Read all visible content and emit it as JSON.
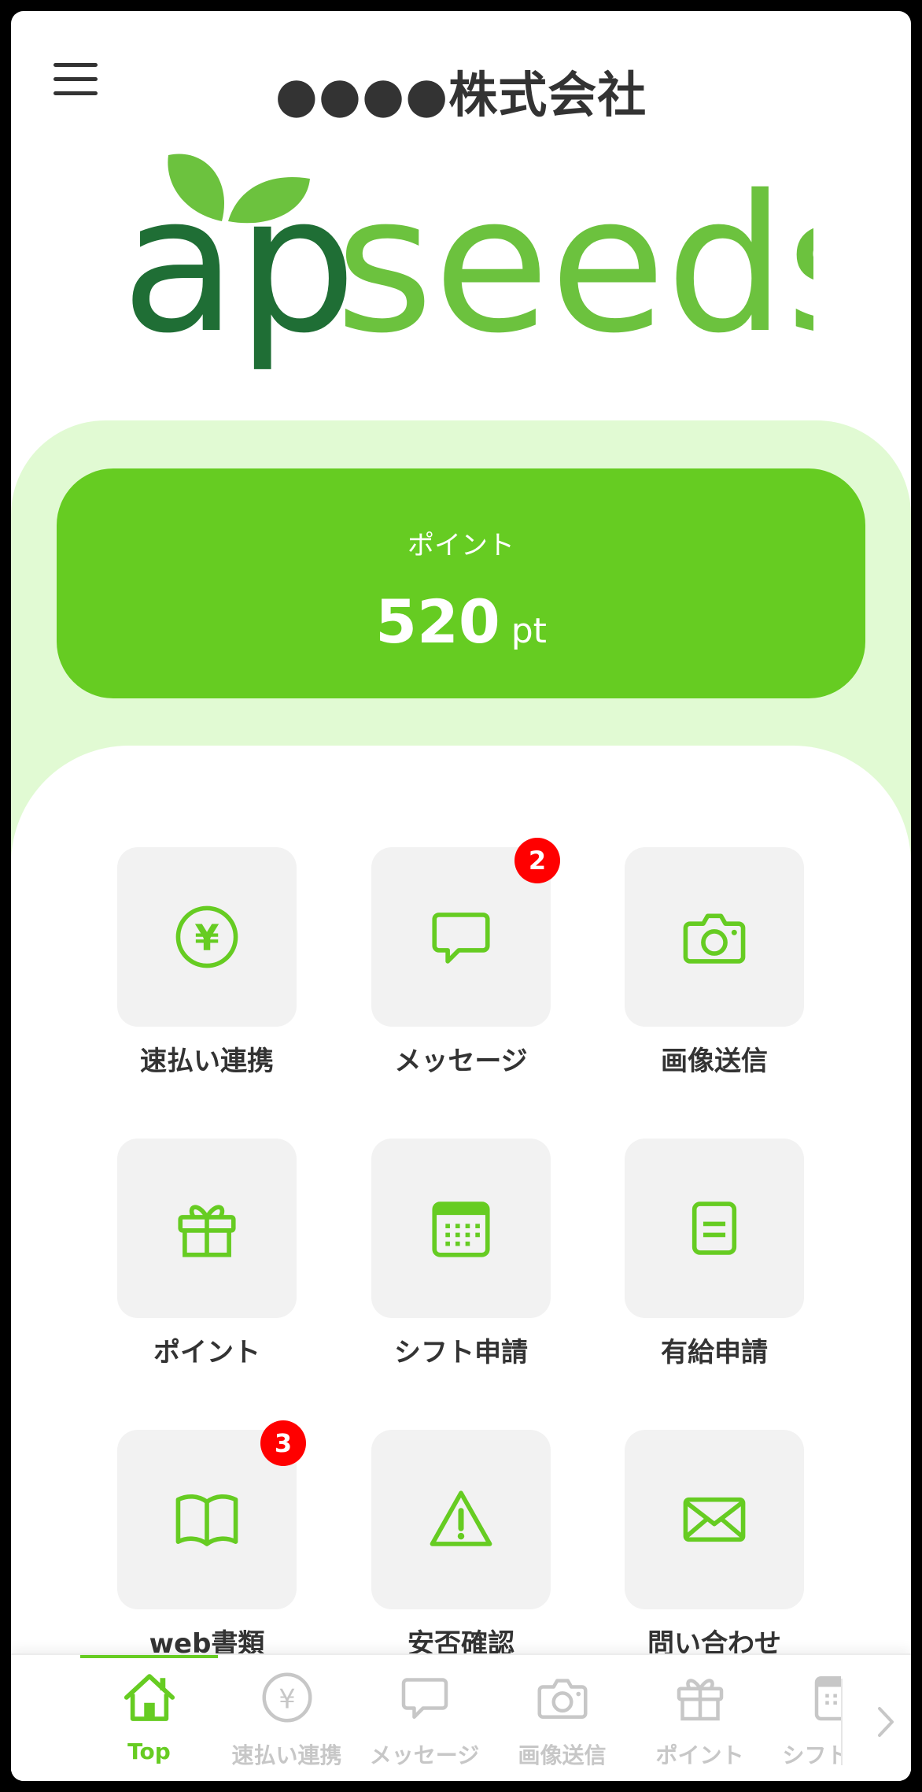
{
  "header": {
    "company_name": "●●●●株式会社",
    "menu_icon": "hamburger-menu-icon"
  },
  "logo": {
    "part1": "ap",
    "part2": "seeds",
    "text": "apseeds"
  },
  "points": {
    "label": "ポイント",
    "value": "520",
    "unit": "pt"
  },
  "menu": [
    {
      "label": "速払い連携",
      "icon": "yen-circle-icon"
    },
    {
      "label": "メッセージ",
      "icon": "chat-bubble-icon",
      "badge": "2"
    },
    {
      "label": "画像送信",
      "icon": "camera-icon"
    },
    {
      "label": "ポイント",
      "icon": "gift-icon"
    },
    {
      "label": "シフト申請",
      "icon": "calendar-icon"
    },
    {
      "label": "有給申請",
      "icon": "document-icon"
    },
    {
      "label": "web書類",
      "icon": "book-icon",
      "badge": "3"
    },
    {
      "label": "安否確認",
      "icon": "warning-icon"
    },
    {
      "label": "問い合わせ",
      "icon": "mail-icon"
    }
  ],
  "bottom_nav": {
    "items": [
      {
        "label": "Top",
        "icon": "home-icon",
        "active": true
      },
      {
        "label": "速払い連携",
        "icon": "yen-circle-icon"
      },
      {
        "label": "メッセージ",
        "icon": "chat-bubble-icon"
      },
      {
        "label": "画像送信",
        "icon": "camera-icon"
      },
      {
        "label": "ポイント",
        "icon": "gift-icon"
      },
      {
        "label": "シフト申請",
        "icon": "calendar-icon"
      }
    ],
    "next_icon": "chevron-right-icon"
  },
  "colors": {
    "accent": "#66cc22",
    "band": "#e1fad3",
    "tile": "#f2f2f2",
    "badge": "#ff0000",
    "inactive": "#c7c7c7",
    "logo_dark": "#1f6e35",
    "logo_light": "#6cc23e"
  }
}
